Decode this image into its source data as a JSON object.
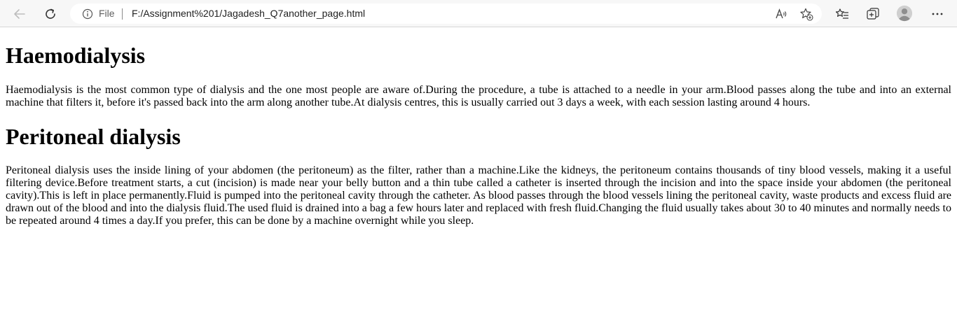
{
  "browser": {
    "address_scheme_label": "File",
    "url": "F:/Assignment%201/Jagadesh_Q7another_page.html"
  },
  "page": {
    "sections": [
      {
        "heading": "Haemodialysis",
        "paragraph": "Haemodialysis is the most common type of dialysis and the one most people are aware of.During the procedure, a tube is attached to a needle in your arm.Blood passes along the tube and into an external machine that filters it, before it's passed back into the arm along another tube.At dialysis centres, this is usually carried out 3 days a week, with each session lasting around 4 hours."
      },
      {
        "heading": "Peritoneal dialysis",
        "paragraph": "Peritoneal dialysis uses the inside lining of your abdomen (the peritoneum) as the filter, rather than a machine.Like the kidneys, the peritoneum contains thousands of tiny blood vessels, making it a useful filtering device.Before treatment starts, a cut (incision) is made near your belly button and a thin tube called a catheter is inserted through the incision and into the space inside your abdomen (the peritoneal cavity).This is left in place permanently.Fluid is pumped into the peritoneal cavity through the catheter. As blood passes through the blood vessels lining the peritoneal cavity, waste products and excess fluid are drawn out of the blood and into the dialysis fluid.The used fluid is drained into a bag a few hours later and replaced with fresh fluid.Changing the fluid usually takes about 30 to 40 minutes and normally needs to be repeated around 4 times a day.If you prefer, this can be done by a machine overnight while you sleep."
      }
    ]
  },
  "icons": [
    "back-arrow-icon",
    "refresh-icon",
    "info-icon",
    "read-aloud-icon",
    "add-favorite-icon",
    "favorites-icon",
    "collections-icon",
    "profile-avatar-icon",
    "more-menu-icon"
  ]
}
